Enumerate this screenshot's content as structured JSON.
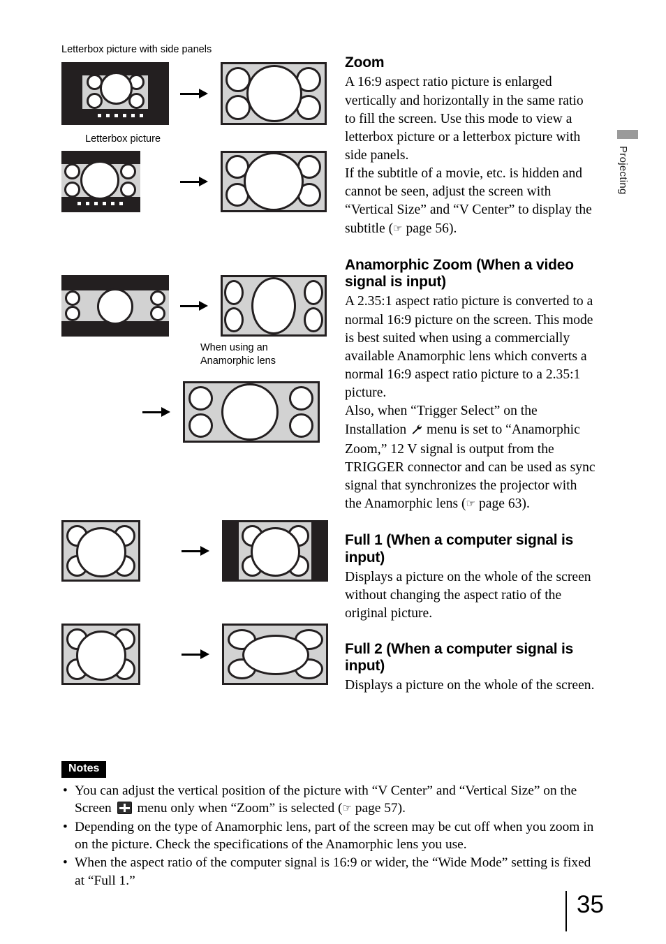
{
  "document": {
    "page_number": "35",
    "edge_tab_label": "Projecting"
  },
  "figures": {
    "caption_letterbox_side_panels": "Letterbox picture with side panels",
    "caption_letterbox": "Letterbox picture",
    "caption_anamorphic_lens": "When using an\nAnamorphic lens",
    "arrow_icon": "right-arrow"
  },
  "sections": [
    {
      "id": "zoom",
      "heading": "Zoom",
      "body": "A 16:9 aspect ratio picture is enlarged vertically and horizontally in the same ratio to fill the screen. Use this mode to view a letterbox picture or a letterbox picture with side panels.",
      "body2_pre": "If the subtitle of a movie, etc. is hidden and cannot be seen, adjust the screen with “Vertical Size” and “V Center” to display the subtitle (",
      "body2_post": " page 56)."
    },
    {
      "id": "anamorphic-zoom",
      "heading": "Anamorphic Zoom (When a video signal is input)",
      "body": "A 2.35:1 aspect ratio picture is converted to a normal 16:9 picture on the screen. This mode is best suited when using a commercially available Anamorphic lens which converts a normal 16:9 aspect ratio picture to a 2.35:1 picture.",
      "body2_pre": "Also, when “Trigger Select” on the Installation ",
      "body2_mid": " menu is set to “Anamorphic Zoom,” 12 V signal is output from the TRIGGER connector and can be used as sync signal that synchronizes the projector with the Anamorphic lens (",
      "body2_post": " page 63)."
    },
    {
      "id": "full-1",
      "heading": "Full 1 (When a computer signal is input)",
      "body": "Displays a picture on the whole of the screen without changing the aspect ratio of the original picture."
    },
    {
      "id": "full-2",
      "heading": "Full 2 (When a computer signal is input)",
      "body": "Displays a picture on the whole of the screen."
    }
  ],
  "notes": {
    "title": "Notes",
    "bullet_glyph": "•",
    "items": [
      {
        "pre": "You can adjust the vertical position of the picture with “V Center” and “Vertical Size” on the Screen ",
        "mid": " menu only when “Zoom” is selected (",
        "post": " page 57)."
      },
      {
        "pre": "Depending on the type of Anamorphic lens, part of the screen may be cut off when you zoom in on the picture. Check the specifications of the Anamorphic lens you use.",
        "mid": "",
        "post": ""
      },
      {
        "pre": "When the aspect ratio of the computer signal is 16:9 or wider, the “Wide Mode” setting is fixed at “Full 1.”",
        "mid": "",
        "post": ""
      }
    ]
  },
  "icons": {
    "pointing_hand": "☞",
    "wrench": "wrench-icon",
    "screen_menu": "screen-menu-icon"
  },
  "colors": {
    "screen_black": "#231f20",
    "screen_gray": "#d2d2d2",
    "blob_white": "#ffffff",
    "tab_gray": "#9a9a9a",
    "notes_badge_bg": "#000000"
  }
}
